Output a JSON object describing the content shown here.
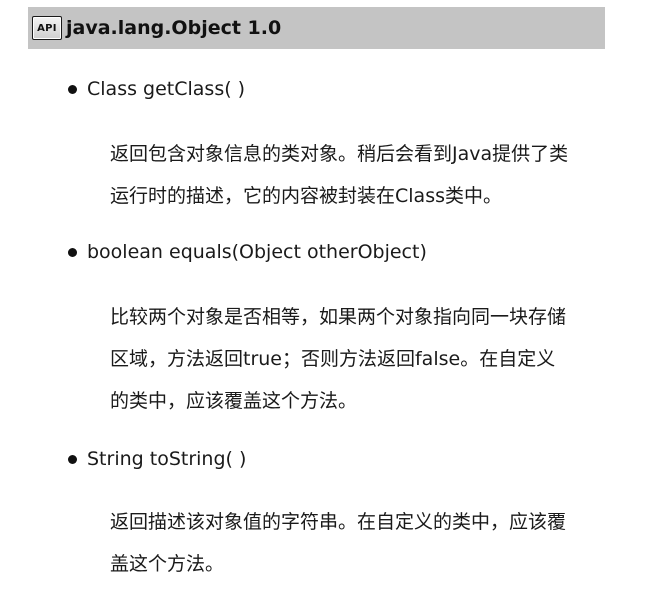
{
  "header": {
    "badge": "API",
    "title": "java.lang.Object 1.0"
  },
  "methods": [
    {
      "signature": "Class getClass( )",
      "description_lines": [
        "返回包含对象信息的类对象。稍后会看到Java提供了类",
        "运行时的描述，它的内容被封装在Class类中。"
      ]
    },
    {
      "signature": "boolean equals(Object otherObject)",
      "description_lines": [
        "比较两个对象是否相等，如果两个对象指向同一块存储",
        "区域，方法返回true；否则方法返回false。在自定义",
        "的类中，应该覆盖这个方法。"
      ]
    },
    {
      "signature": "String toString( )",
      "description_lines": [
        "返回描述该对象值的字符串。在自定义的类中，应该覆",
        "盖这个方法。"
      ]
    }
  ]
}
